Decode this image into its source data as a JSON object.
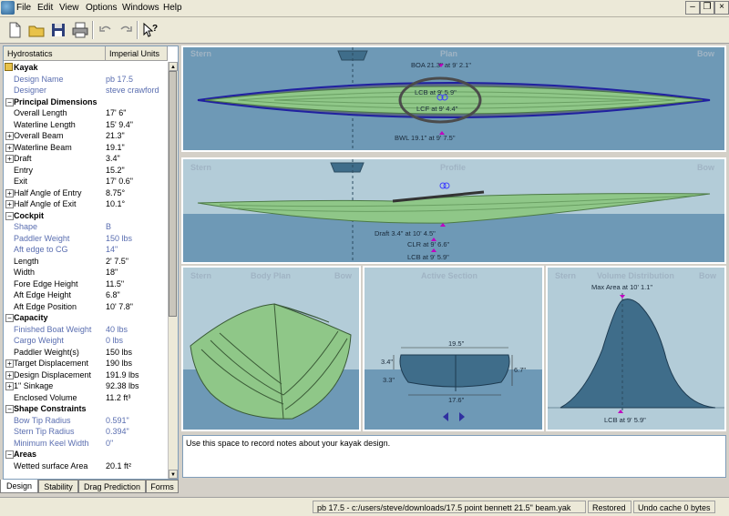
{
  "menu": [
    "File",
    "Edit",
    "View",
    "Options",
    "Windows",
    "Help"
  ],
  "panel": {
    "col1": "Hydrostatics",
    "col2": "Imperial Units",
    "root": "Kayak",
    "rows": [
      {
        "t": "input",
        "label": "Design Name",
        "value": "pb 17.5"
      },
      {
        "t": "input",
        "label": "Designer",
        "value": "steve crawford"
      },
      {
        "t": "sec",
        "label": "Principal Dimensions"
      },
      {
        "t": "plain",
        "label": "Overall Length",
        "value": "17' 6\""
      },
      {
        "t": "plain",
        "label": "Waterline Length",
        "value": "15' 9.4\""
      },
      {
        "t": "exp",
        "label": "Overall Beam",
        "value": "21.3\""
      },
      {
        "t": "exp",
        "label": "Waterline Beam",
        "value": "19.1\""
      },
      {
        "t": "exp",
        "label": "Draft",
        "value": "3.4\""
      },
      {
        "t": "plain",
        "label": "Entry",
        "value": "15.2\""
      },
      {
        "t": "plain",
        "label": "Exit",
        "value": "17' 0.6\""
      },
      {
        "t": "exp",
        "label": "Half Angle of Entry",
        "value": "8.75°"
      },
      {
        "t": "exp",
        "label": "Half Angle of Exit",
        "value": "10.1°"
      },
      {
        "t": "sec",
        "label": "Cockpit"
      },
      {
        "t": "input",
        "label": "Shape",
        "value": "B"
      },
      {
        "t": "input",
        "label": "Paddler Weight",
        "value": "150 lbs"
      },
      {
        "t": "input",
        "label": "Aft edge to CG",
        "value": "14\""
      },
      {
        "t": "plain",
        "label": "Length",
        "value": "2' 7.5\""
      },
      {
        "t": "plain",
        "label": "Width",
        "value": "18\""
      },
      {
        "t": "plain",
        "label": "Fore Edge Height",
        "value": "11.5\""
      },
      {
        "t": "plain",
        "label": "Aft Edge Height",
        "value": "6.8\""
      },
      {
        "t": "plain",
        "label": "Aft Edge Position",
        "value": "10' 7.8\""
      },
      {
        "t": "sec",
        "label": "Capacity"
      },
      {
        "t": "input",
        "label": "Finished Boat Weight",
        "value": "40 lbs"
      },
      {
        "t": "input",
        "label": "Cargo Weight",
        "value": "0 lbs"
      },
      {
        "t": "plain",
        "label": "Paddler Weight(s)",
        "value": "150 lbs"
      },
      {
        "t": "exp",
        "label": "Target Displacement",
        "value": "190 lbs"
      },
      {
        "t": "exp",
        "label": "Design Displacement",
        "value": "191.9 lbs"
      },
      {
        "t": "exp",
        "label": "1\" Sinkage",
        "value": "92.38 lbs"
      },
      {
        "t": "plain",
        "label": "Enclosed Volume",
        "value": "11.2 ft³"
      },
      {
        "t": "sec",
        "label": "Shape Constraints"
      },
      {
        "t": "input",
        "label": "Bow Tip Radius",
        "value": "0.591\""
      },
      {
        "t": "input",
        "label": "Stern Tip Radius",
        "value": "0.394\""
      },
      {
        "t": "input",
        "label": "Minimum Keel Width",
        "value": "0\""
      },
      {
        "t": "sec",
        "label": "Areas"
      },
      {
        "t": "plain",
        "label": "Wetted surface Area",
        "value": "20.1 ft²"
      }
    ]
  },
  "tabs": [
    "Design",
    "Stability",
    "Drag Prediction",
    "Forms"
  ],
  "plan": {
    "stern": "Stern",
    "title": "Plan",
    "bow": "Bow",
    "boa": "BOA 21.3\" at 9' 2.1\"",
    "lcb": "LCB at 9' 5.9\"",
    "lcf": "LCF at 9' 4.4\"",
    "bwl": "BWL 19.1\" at 9' 7.5\""
  },
  "profile": {
    "stern": "Stern",
    "title": "Profile",
    "bow": "Bow",
    "draft": "Draft 3.4\" at 10' 4.5\"",
    "clr": "CLR at 9' 6.6\"",
    "lcb": "LCB at 9' 5.9\""
  },
  "body": {
    "stern": "Stern",
    "title": "Body Plan",
    "bow": "Bow"
  },
  "section": {
    "title": "Active Section",
    "top": "19.5\"",
    "bottom": "17.6\"",
    "left": "3.4\"",
    "left2": "3.3\"",
    "right": "6.7\""
  },
  "volume": {
    "stern": "Stern",
    "title": "Volume Distribution",
    "bow": "Bow",
    "max": "Max Area at 10' 1.1\"",
    "lcb": "LCB at 9' 5.9\""
  },
  "notes": "Use this space to record notes about your kayak design.",
  "status": {
    "file": "pb 17.5 - c:/users/steve/downloads/17.5 point bennett 21.5\" beam.yak",
    "state": "Restored",
    "undo": "Undo cache 0 bytes"
  },
  "colors": {
    "water": "#6e99b6",
    "hull": "#8fc788",
    "deck": "#3f6d8a"
  }
}
